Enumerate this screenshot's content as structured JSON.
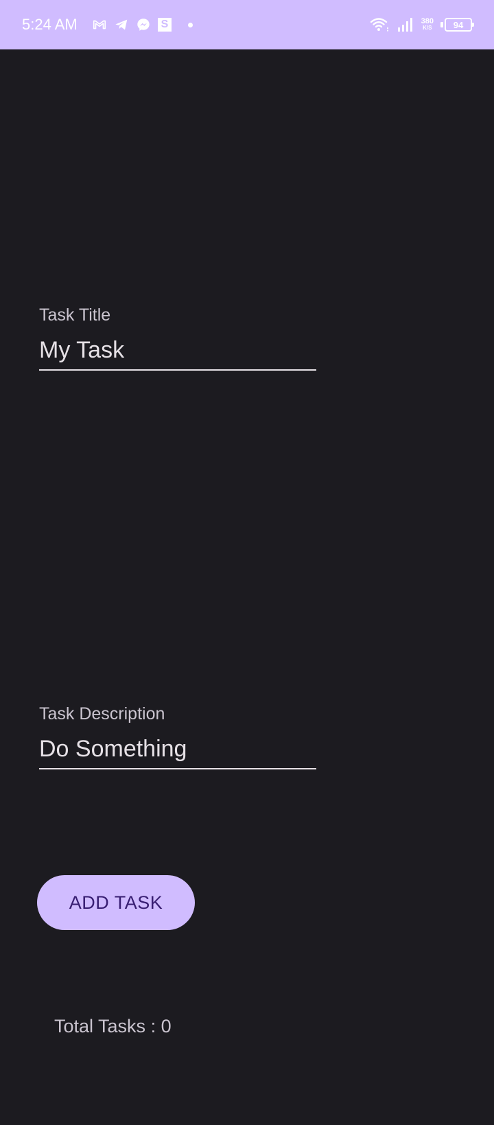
{
  "status_bar": {
    "time": "5:24 AM",
    "left_icons": [
      "gmail-icon",
      "telegram-icon",
      "messenger-icon",
      "s-app-icon",
      "notification-dot-icon"
    ],
    "s_icon_letter": "S",
    "net_speed_value": "380",
    "net_speed_unit": "K/S",
    "battery_level": "94",
    "right_icons": [
      "wifi-icon",
      "signal-icon",
      "battery-icon"
    ]
  },
  "form": {
    "title_label": "Task Title",
    "title_value": "My Task",
    "description_label": "Task Description",
    "description_value": "Do Something"
  },
  "actions": {
    "add_task_label": "ADD TASK"
  },
  "summary": {
    "total_tasks_text": "Total Tasks : 0"
  },
  "colors": {
    "background": "#1c1b20",
    "accent": "#d0bcff",
    "button_text": "#381e72",
    "text_primary": "#e6e1e6",
    "text_secondary": "#cac4cf"
  }
}
